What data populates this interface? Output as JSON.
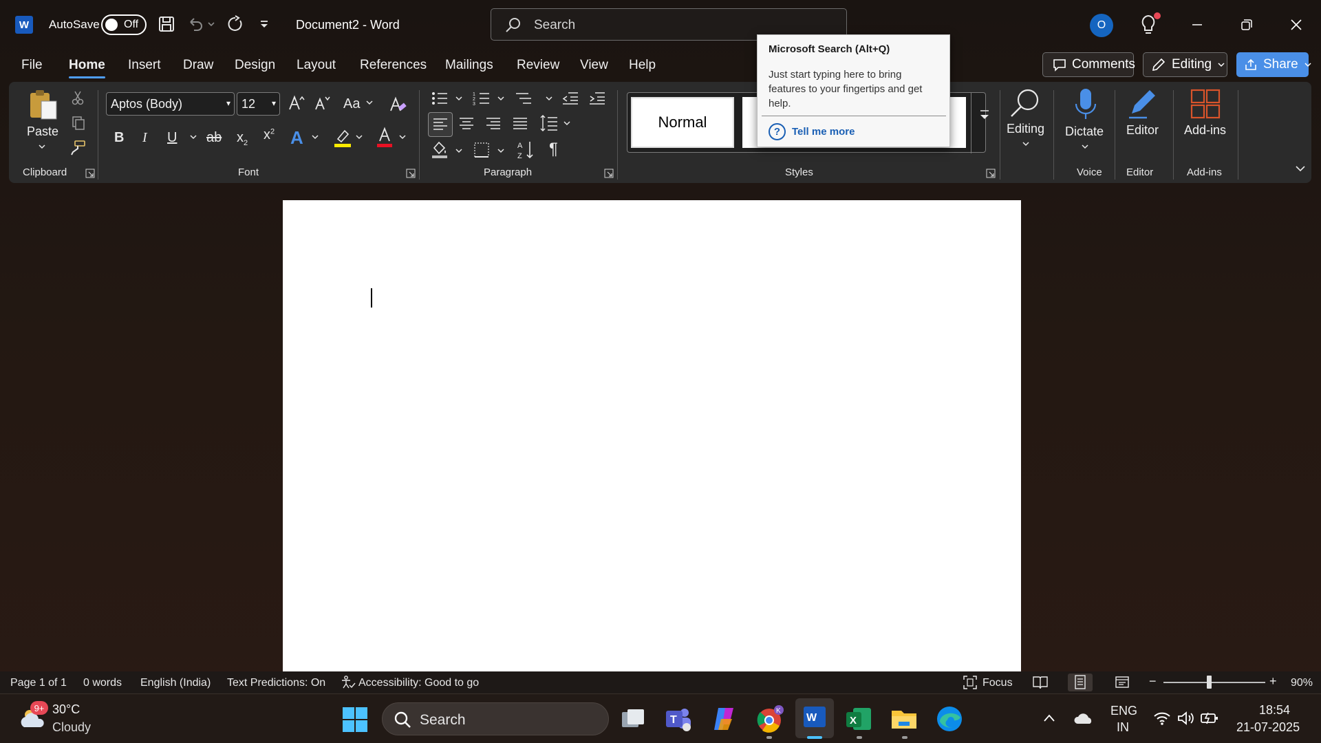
{
  "titlebar": {
    "app_logo": "W",
    "autosave_label": "AutoSave",
    "autosave_state": "Off",
    "document_title": "Document2  -  Word",
    "search_placeholder": "Search",
    "account_initial": "O",
    "icons": [
      "save-icon",
      "undo-icon",
      "redo-icon",
      "customize-qat-icon",
      "lightbulb-icon",
      "minimize-icon",
      "restore-icon",
      "close-icon"
    ]
  },
  "menu": {
    "tabs": [
      "File",
      "Home",
      "Insert",
      "Draw",
      "Design",
      "Layout",
      "References",
      "Mailings",
      "Review",
      "View",
      "Help"
    ],
    "active_tab": "Home",
    "comments_label": "Comments",
    "editing_label": "Editing",
    "share_label": "Share"
  },
  "ribbon": {
    "clipboard": {
      "paste_label": "Paste",
      "group_label": "Clipboard"
    },
    "font": {
      "font_name": "Aptos (Body)",
      "font_size": "12",
      "group_label": "Font",
      "case_label": "Aa"
    },
    "paragraph": {
      "group_label": "Paragraph"
    },
    "styles": {
      "normal_label": "Normal",
      "group_label": "Styles"
    },
    "editing": {
      "label": "Editing"
    },
    "voice": {
      "dictate_label": "Dictate",
      "group_label": "Voice"
    },
    "editor": {
      "label": "Editor",
      "group_label": "Editor"
    },
    "addins": {
      "label": "Add-ins",
      "group_label": "Add-ins"
    }
  },
  "tooltip": {
    "title": "Microsoft Search (Alt+Q)",
    "body": "Just start typing here to bring features to your fingertips and get help.",
    "link": "Tell me more"
  },
  "statusbar": {
    "page": "Page 1 of 1",
    "words": "0 words",
    "language": "English (India)",
    "predictions": "Text Predictions: On",
    "accessibility": "Accessibility: Good to go",
    "focus": "Focus",
    "zoom_minus": "−",
    "zoom_plus": "+",
    "zoom": "90%",
    "zoom_level": 0.9
  },
  "taskbar": {
    "weather_badge": "9+",
    "temperature": "30°C",
    "condition": "Cloudy",
    "search_placeholder": "Search",
    "lang_line1": "ENG",
    "lang_line2": "IN",
    "time": "18:54",
    "date": "21-07-2025"
  },
  "colors": {
    "accent": "#4f9ef8",
    "share": "#4a8fe7",
    "word_blue": "#185abd",
    "highlight_yellow": "#ffeb00",
    "font_red": "#e81123",
    "addins_orange": "#d9542b"
  }
}
